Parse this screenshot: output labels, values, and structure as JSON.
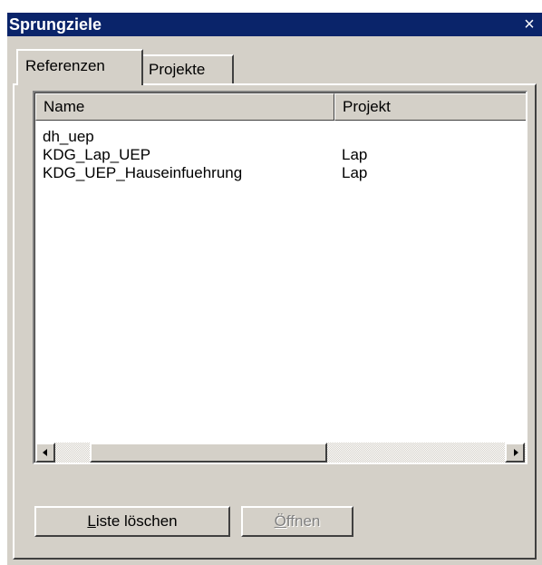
{
  "window": {
    "title": "Sprungziele",
    "close_glyph": "×"
  },
  "tabs": [
    {
      "label": "Referenzen",
      "active": true
    },
    {
      "label": "Projekte",
      "active": false
    }
  ],
  "list": {
    "columns": [
      "Name",
      "Projekt"
    ],
    "rows": [
      {
        "name": "dh_uep",
        "projekt": ""
      },
      {
        "name": "KDG_Lap_UEP",
        "projekt": "Lap"
      },
      {
        "name": "KDG_UEP_Hauseinfuehrung",
        "projekt": "Lap"
      }
    ]
  },
  "buttons": {
    "clear": {
      "accel": "L",
      "rest": "iste löschen",
      "enabled": true
    },
    "open": {
      "accel": "Ö",
      "rest": "ffnen",
      "enabled": false
    }
  }
}
